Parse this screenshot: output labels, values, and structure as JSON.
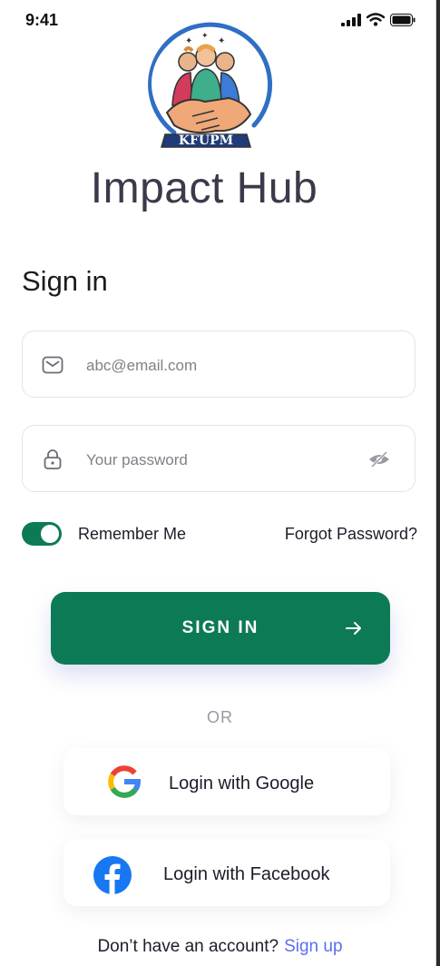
{
  "status_bar": {
    "time": "9:41"
  },
  "logo": {
    "text": "KFUPM"
  },
  "app": {
    "title": "Impact Hub"
  },
  "form": {
    "heading": "Sign in",
    "email": {
      "placeholder": "abc@email.com",
      "value": "",
      "icon": "mail-icon"
    },
    "password": {
      "placeholder": "Your password",
      "value": "",
      "icon": "lock-icon",
      "toggle_icon": "eye-off-icon"
    },
    "remember_label": "Remember Me",
    "remember_on": true,
    "forgot_label": "Forgot Password?",
    "submit_label": "SIGN IN",
    "submit_icon": "arrow-right-icon"
  },
  "divider": "OR",
  "social": [
    {
      "label": "Login with Google",
      "icon": "google-icon"
    },
    {
      "label": "Login with Facebook",
      "icon": "facebook-icon"
    }
  ],
  "footer": {
    "prompt": "Don’t have an account?",
    "link": "Sign up"
  },
  "colors": {
    "primary": "#0d7a56",
    "link": "#5a6ef0",
    "title": "#3a3a4a",
    "facebook": "#1877f2"
  }
}
